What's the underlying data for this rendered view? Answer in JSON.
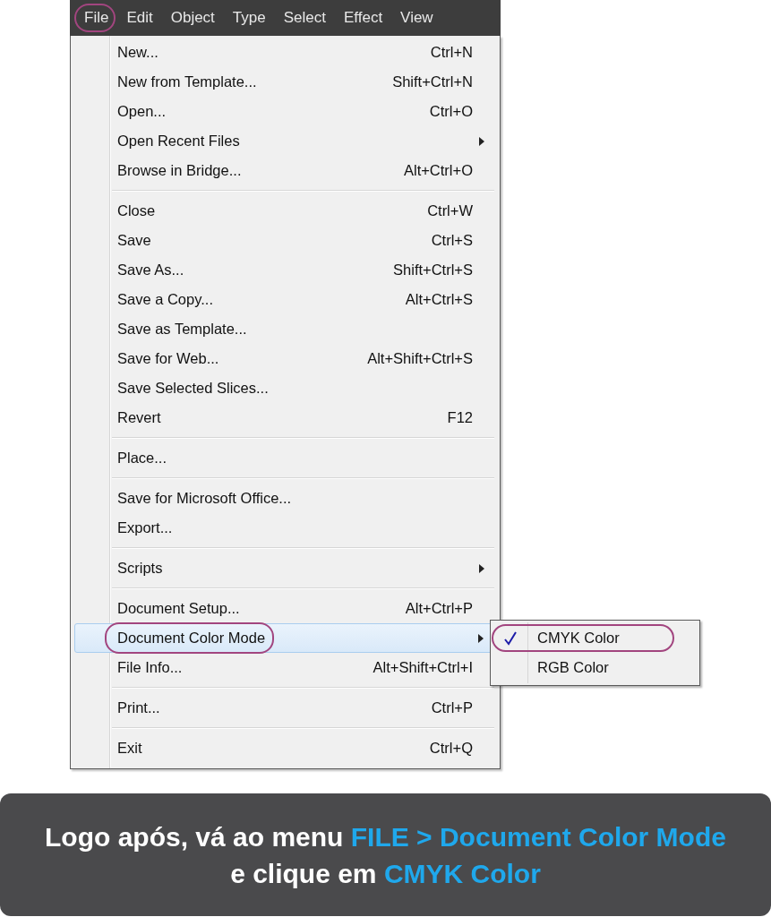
{
  "menu_bar": {
    "items": [
      {
        "label": "File",
        "circled": true
      },
      {
        "label": "Edit",
        "circled": false
      },
      {
        "label": "Object",
        "circled": false
      },
      {
        "label": "Type",
        "circled": false
      },
      {
        "label": "Select",
        "circled": false
      },
      {
        "label": "Effect",
        "circled": false
      },
      {
        "label": "View",
        "circled": false
      }
    ]
  },
  "menu": {
    "groups": [
      [
        {
          "label": "New...",
          "shortcut": "Ctrl+N",
          "selected": false,
          "circled": false
        },
        {
          "label": "New from Template...",
          "shortcut": "Shift+Ctrl+N",
          "selected": false,
          "circled": false
        },
        {
          "label": "Open...",
          "shortcut": "Ctrl+O",
          "selected": false,
          "circled": false
        },
        {
          "label": "Open Recent Files",
          "arrow": true,
          "selected": false,
          "circled": false
        },
        {
          "label": "Browse in Bridge...",
          "shortcut": "Alt+Ctrl+O",
          "selected": false,
          "circled": false
        }
      ],
      [
        {
          "label": "Close",
          "shortcut": "Ctrl+W",
          "selected": false,
          "circled": false
        },
        {
          "label": "Save",
          "shortcut": "Ctrl+S",
          "selected": false,
          "circled": false
        },
        {
          "label": "Save As...",
          "shortcut": "Shift+Ctrl+S",
          "selected": false,
          "circled": false
        },
        {
          "label": "Save a Copy...",
          "shortcut": "Alt+Ctrl+S",
          "selected": false,
          "circled": false
        },
        {
          "label": "Save as Template...",
          "selected": false,
          "circled": false
        },
        {
          "label": "Save for Web...",
          "shortcut": "Alt+Shift+Ctrl+S",
          "selected": false,
          "circled": false
        },
        {
          "label": "Save Selected Slices...",
          "selected": false,
          "circled": false
        },
        {
          "label": "Revert",
          "shortcut": "F12",
          "selected": false,
          "circled": false
        }
      ],
      [
        {
          "label": "Place...",
          "selected": false,
          "circled": false
        }
      ],
      [
        {
          "label": "Save for Microsoft Office...",
          "selected": false,
          "circled": false
        },
        {
          "label": "Export...",
          "selected": false,
          "circled": false
        }
      ],
      [
        {
          "label": "Scripts",
          "arrow": true,
          "selected": false,
          "circled": false
        }
      ],
      [
        {
          "label": "Document Setup...",
          "shortcut": "Alt+Ctrl+P",
          "selected": false,
          "circled": false
        },
        {
          "label": "Document Color Mode",
          "arrow": true,
          "selected": true,
          "circled": true,
          "submenu": {
            "items": [
              {
                "label": "CMYK Color",
                "checked": true,
                "circled": true
              },
              {
                "label": "RGB Color",
                "checked": false,
                "circled": false
              }
            ]
          }
        },
        {
          "label": "File Info...",
          "shortcut": "Alt+Shift+Ctrl+I",
          "selected": false,
          "circled": false
        }
      ],
      [
        {
          "label": "Print...",
          "shortcut": "Ctrl+P",
          "selected": false,
          "circled": false
        }
      ],
      [
        {
          "label": "Exit",
          "shortcut": "Ctrl+Q",
          "selected": false,
          "circled": false
        }
      ]
    ]
  },
  "caption": {
    "lines": [
      [
        {
          "text": "Logo após, vá ao menu ",
          "highlight": false
        },
        {
          "text": "FILE > Document Color Mode",
          "highlight": true
        }
      ],
      [
        {
          "text": "e clique em ",
          "highlight": false
        },
        {
          "text": "CMYK Color",
          "highlight": true
        }
      ]
    ]
  }
}
